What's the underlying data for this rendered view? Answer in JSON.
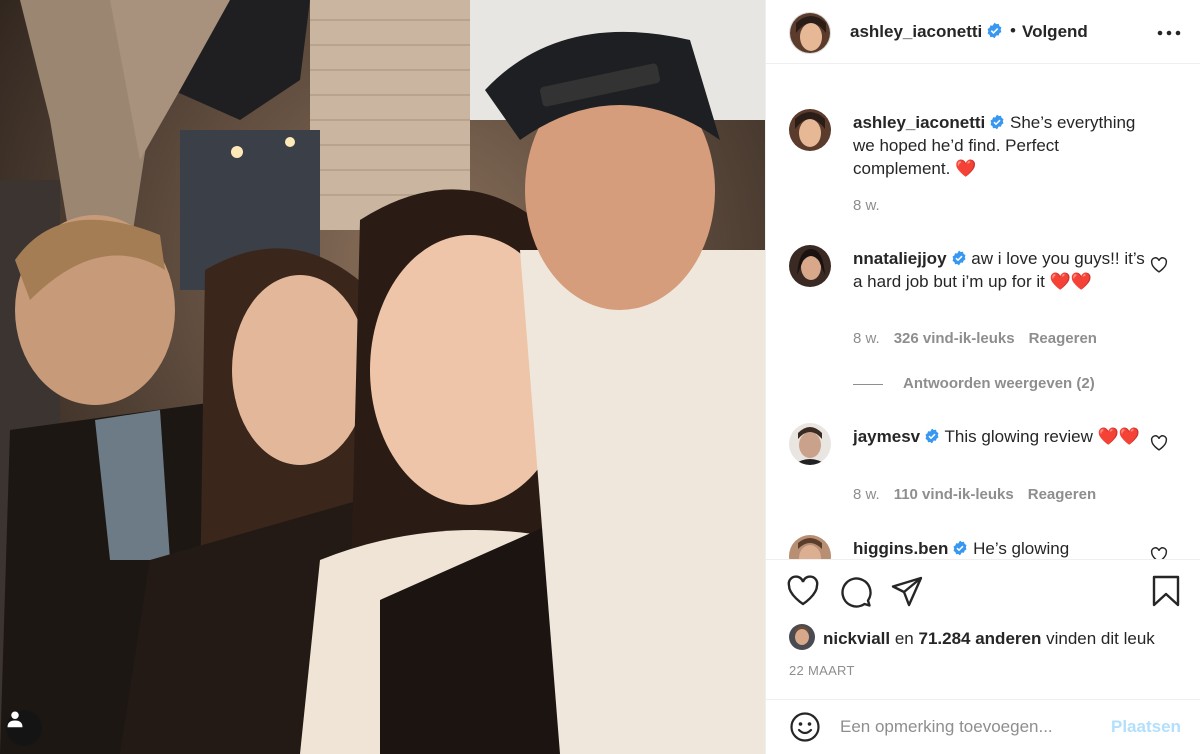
{
  "post": {
    "author": "ashley_iaconetti",
    "follow_status": "Volgend",
    "caption_text": "She’s everything we hoped he’d find. Perfect complement. ❤️",
    "caption_age": "8 w."
  },
  "comments": [
    {
      "username": "nnataliejjoy",
      "verified": true,
      "text": "aw i love you guys!! it’s a hard job but i’m up for it ❤️❤️",
      "age": "8 w.",
      "likes": "326 vind-ik-leuks",
      "reply": "Reageren",
      "view_replies": "Antwoorden weergeven (2)"
    },
    {
      "username": "jaymesv",
      "verified": true,
      "text": "This glowing review ❤️❤️",
      "age": "8 w.",
      "likes": "110 vind-ik-leuks",
      "reply": "Reageren"
    },
    {
      "username": "higgins.ben",
      "verified": true,
      "text": "He’s glowing"
    }
  ],
  "likes_summary": {
    "liker": "nickviall",
    "connector": "en",
    "others": "71.284 anderen",
    "suffix": "vinden dit leuk"
  },
  "date": "22 MAART",
  "composer": {
    "placeholder": "Een opmerking toevoegen...",
    "post_label": "Plaatsen"
  },
  "icons": {
    "like": "heart-icon",
    "comment": "comment-bubble-icon",
    "share": "paper-plane-icon",
    "save": "bookmark-icon",
    "more": "more-options-icon",
    "emoji": "emoji-smile-icon",
    "tags": "user-tag-icon",
    "verified": "verified-badge-icon"
  },
  "colors": {
    "verified_blue": "#3897f0",
    "heart_red": "#ed4956",
    "post_button_disabled": "#b2dffc",
    "meta_gray": "#8e8e8e"
  }
}
